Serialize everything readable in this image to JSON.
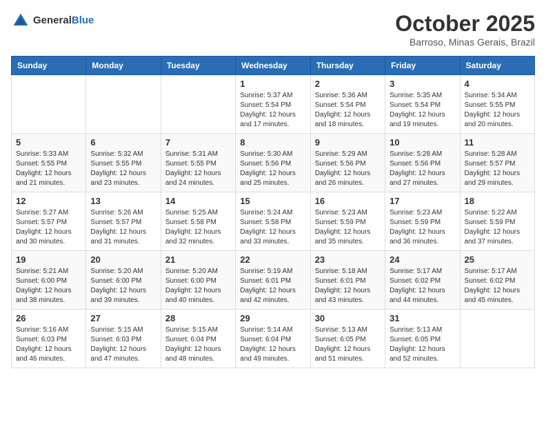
{
  "header": {
    "logo_general": "General",
    "logo_blue": "Blue",
    "month_year": "October 2025",
    "location": "Barroso, Minas Gerais, Brazil"
  },
  "weekdays": [
    "Sunday",
    "Monday",
    "Tuesday",
    "Wednesday",
    "Thursday",
    "Friday",
    "Saturday"
  ],
  "weeks": [
    [
      {
        "day": "",
        "sunrise": "",
        "sunset": "",
        "daylight": ""
      },
      {
        "day": "",
        "sunrise": "",
        "sunset": "",
        "daylight": ""
      },
      {
        "day": "",
        "sunrise": "",
        "sunset": "",
        "daylight": ""
      },
      {
        "day": "1",
        "sunrise": "Sunrise: 5:37 AM",
        "sunset": "Sunset: 5:54 PM",
        "daylight": "Daylight: 12 hours and 17 minutes."
      },
      {
        "day": "2",
        "sunrise": "Sunrise: 5:36 AM",
        "sunset": "Sunset: 5:54 PM",
        "daylight": "Daylight: 12 hours and 18 minutes."
      },
      {
        "day": "3",
        "sunrise": "Sunrise: 5:35 AM",
        "sunset": "Sunset: 5:54 PM",
        "daylight": "Daylight: 12 hours and 19 minutes."
      },
      {
        "day": "4",
        "sunrise": "Sunrise: 5:34 AM",
        "sunset": "Sunset: 5:55 PM",
        "daylight": "Daylight: 12 hours and 20 minutes."
      }
    ],
    [
      {
        "day": "5",
        "sunrise": "Sunrise: 5:33 AM",
        "sunset": "Sunset: 5:55 PM",
        "daylight": "Daylight: 12 hours and 21 minutes."
      },
      {
        "day": "6",
        "sunrise": "Sunrise: 5:32 AM",
        "sunset": "Sunset: 5:55 PM",
        "daylight": "Daylight: 12 hours and 23 minutes."
      },
      {
        "day": "7",
        "sunrise": "Sunrise: 5:31 AM",
        "sunset": "Sunset: 5:55 PM",
        "daylight": "Daylight: 12 hours and 24 minutes."
      },
      {
        "day": "8",
        "sunrise": "Sunrise: 5:30 AM",
        "sunset": "Sunset: 5:56 PM",
        "daylight": "Daylight: 12 hours and 25 minutes."
      },
      {
        "day": "9",
        "sunrise": "Sunrise: 5:29 AM",
        "sunset": "Sunset: 5:56 PM",
        "daylight": "Daylight: 12 hours and 26 minutes."
      },
      {
        "day": "10",
        "sunrise": "Sunrise: 5:28 AM",
        "sunset": "Sunset: 5:56 PM",
        "daylight": "Daylight: 12 hours and 27 minutes."
      },
      {
        "day": "11",
        "sunrise": "Sunrise: 5:28 AM",
        "sunset": "Sunset: 5:57 PM",
        "daylight": "Daylight: 12 hours and 29 minutes."
      }
    ],
    [
      {
        "day": "12",
        "sunrise": "Sunrise: 5:27 AM",
        "sunset": "Sunset: 5:57 PM",
        "daylight": "Daylight: 12 hours and 30 minutes."
      },
      {
        "day": "13",
        "sunrise": "Sunrise: 5:26 AM",
        "sunset": "Sunset: 5:57 PM",
        "daylight": "Daylight: 12 hours and 31 minutes."
      },
      {
        "day": "14",
        "sunrise": "Sunrise: 5:25 AM",
        "sunset": "Sunset: 5:58 PM",
        "daylight": "Daylight: 12 hours and 32 minutes."
      },
      {
        "day": "15",
        "sunrise": "Sunrise: 5:24 AM",
        "sunset": "Sunset: 5:58 PM",
        "daylight": "Daylight: 12 hours and 33 minutes."
      },
      {
        "day": "16",
        "sunrise": "Sunrise: 5:23 AM",
        "sunset": "Sunset: 5:59 PM",
        "daylight": "Daylight: 12 hours and 35 minutes."
      },
      {
        "day": "17",
        "sunrise": "Sunrise: 5:23 AM",
        "sunset": "Sunset: 5:59 PM",
        "daylight": "Daylight: 12 hours and 36 minutes."
      },
      {
        "day": "18",
        "sunrise": "Sunrise: 5:22 AM",
        "sunset": "Sunset: 5:59 PM",
        "daylight": "Daylight: 12 hours and 37 minutes."
      }
    ],
    [
      {
        "day": "19",
        "sunrise": "Sunrise: 5:21 AM",
        "sunset": "Sunset: 6:00 PM",
        "daylight": "Daylight: 12 hours and 38 minutes."
      },
      {
        "day": "20",
        "sunrise": "Sunrise: 5:20 AM",
        "sunset": "Sunset: 6:00 PM",
        "daylight": "Daylight: 12 hours and 39 minutes."
      },
      {
        "day": "21",
        "sunrise": "Sunrise: 5:20 AM",
        "sunset": "Sunset: 6:00 PM",
        "daylight": "Daylight: 12 hours and 40 minutes."
      },
      {
        "day": "22",
        "sunrise": "Sunrise: 5:19 AM",
        "sunset": "Sunset: 6:01 PM",
        "daylight": "Daylight: 12 hours and 42 minutes."
      },
      {
        "day": "23",
        "sunrise": "Sunrise: 5:18 AM",
        "sunset": "Sunset: 6:01 PM",
        "daylight": "Daylight: 12 hours and 43 minutes."
      },
      {
        "day": "24",
        "sunrise": "Sunrise: 5:17 AM",
        "sunset": "Sunset: 6:02 PM",
        "daylight": "Daylight: 12 hours and 44 minutes."
      },
      {
        "day": "25",
        "sunrise": "Sunrise: 5:17 AM",
        "sunset": "Sunset: 6:02 PM",
        "daylight": "Daylight: 12 hours and 45 minutes."
      }
    ],
    [
      {
        "day": "26",
        "sunrise": "Sunrise: 5:16 AM",
        "sunset": "Sunset: 6:03 PM",
        "daylight": "Daylight: 12 hours and 46 minutes."
      },
      {
        "day": "27",
        "sunrise": "Sunrise: 5:15 AM",
        "sunset": "Sunset: 6:03 PM",
        "daylight": "Daylight: 12 hours and 47 minutes."
      },
      {
        "day": "28",
        "sunrise": "Sunrise: 5:15 AM",
        "sunset": "Sunset: 6:04 PM",
        "daylight": "Daylight: 12 hours and 48 minutes."
      },
      {
        "day": "29",
        "sunrise": "Sunrise: 5:14 AM",
        "sunset": "Sunset: 6:04 PM",
        "daylight": "Daylight: 12 hours and 49 minutes."
      },
      {
        "day": "30",
        "sunrise": "Sunrise: 5:13 AM",
        "sunset": "Sunset: 6:05 PM",
        "daylight": "Daylight: 12 hours and 51 minutes."
      },
      {
        "day": "31",
        "sunrise": "Sunrise: 5:13 AM",
        "sunset": "Sunset: 6:05 PM",
        "daylight": "Daylight: 12 hours and 52 minutes."
      },
      {
        "day": "",
        "sunrise": "",
        "sunset": "",
        "daylight": ""
      }
    ]
  ]
}
